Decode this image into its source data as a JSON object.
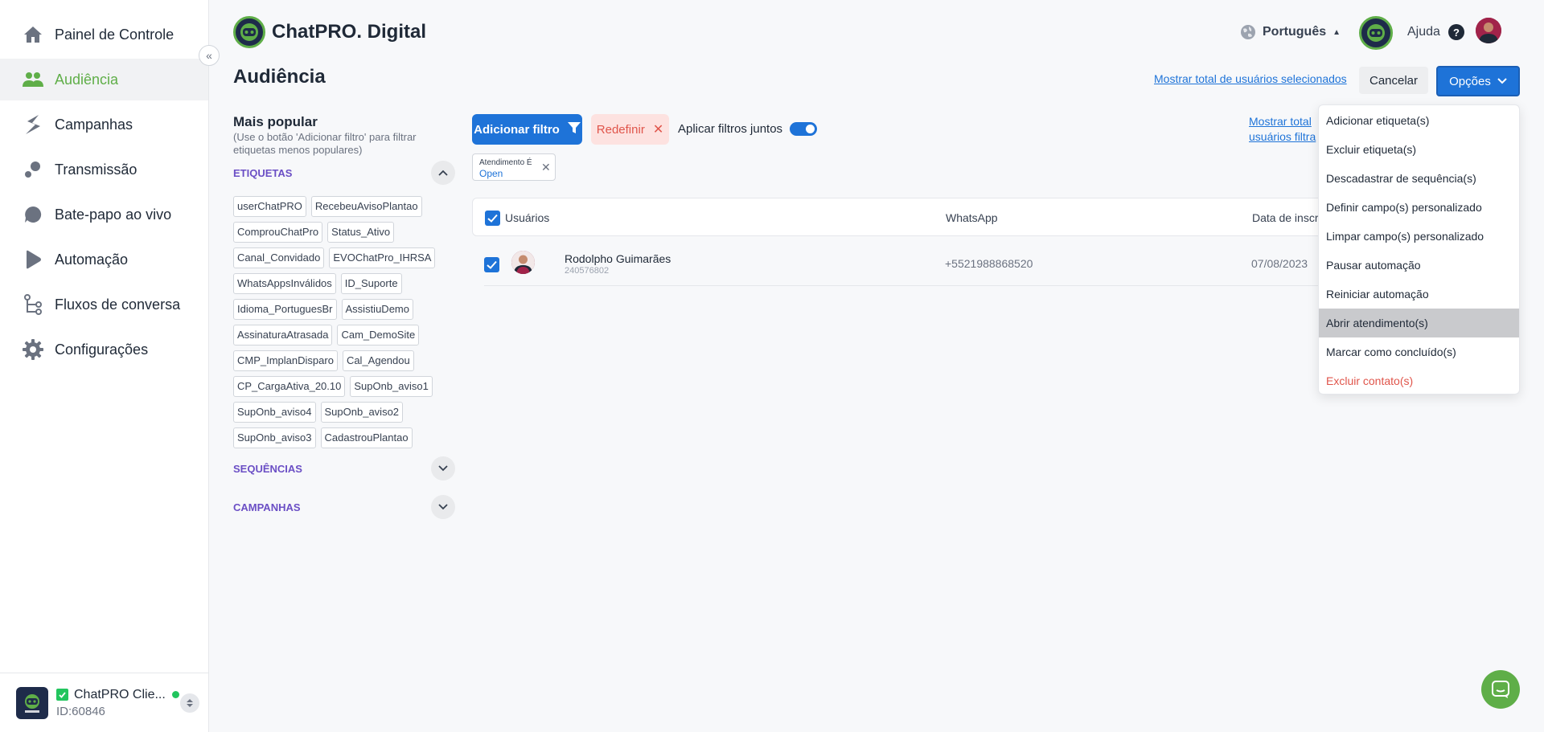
{
  "sidebar": {
    "items": [
      {
        "label": "Painel de Controle",
        "icon": "home-icon",
        "active": false
      },
      {
        "label": "Audiência",
        "icon": "users-icon",
        "active": true
      },
      {
        "label": "Campanhas",
        "icon": "campaigns-icon",
        "active": false
      },
      {
        "label": "Transmissão",
        "icon": "broadcast-icon",
        "active": false
      },
      {
        "label": "Bate-papo ao vivo",
        "icon": "chat-bubble-icon",
        "active": false
      },
      {
        "label": "Automação",
        "icon": "play-icon",
        "active": false
      },
      {
        "label": "Fluxos de conversa",
        "icon": "flow-icon",
        "active": false
      },
      {
        "label": "Configurações",
        "icon": "gear-icon",
        "active": false
      }
    ],
    "collapse_glyph": "«",
    "footer": {
      "name": "ChatPRO Clie...",
      "id": "ID:60846",
      "logo_text": "ChatPRO"
    }
  },
  "header": {
    "brand": "ChatPRO. Digital",
    "language": "Português",
    "help": "Ajuda"
  },
  "page": {
    "title": "Audiência",
    "show_total_link": "Mostrar total de usuários selecionados",
    "cancel": "Cancelar",
    "options": "Opções"
  },
  "filters_panel": {
    "title": "Mais popular",
    "hint": "(Use o botão 'Adicionar filtro' para filtrar etiquetas menos populares)",
    "sections": {
      "tags": "ETIQUETAS",
      "sequences": "SEQUÊNCIAS",
      "campaigns": "CAMPANHAS"
    },
    "tags": [
      "userChatPRO",
      "RecebeuAvisoPlantao",
      "ComprouChatPro",
      "Status_Ativo",
      "Canal_Convidado",
      "EVOChatPro_IHRSA",
      "WhatsAppsInválidos",
      "ID_Suporte",
      "Idioma_PortuguesBr",
      "AssistiuDemo",
      "AssinaturaAtrasada",
      "Cam_DemoSite",
      "CMP_ImplanDisparo",
      "Cal_Agendou",
      "CP_CargaAtiva_20.10",
      "SupOnb_aviso1",
      "SupOnb_aviso4",
      "SupOnb_aviso2",
      "SupOnb_aviso3",
      "CadastrouPlantao"
    ]
  },
  "filter_bar": {
    "add_filter": "Adicionar filtro",
    "reset": "Redefinir",
    "apply_together": "Aplicar filtros juntos",
    "apply_together_on": true,
    "show_total_line1": "Mostrar total",
    "show_total_line2": "usuários filtra",
    "active_filter": {
      "label": "Atendimento É",
      "value": "Open"
    }
  },
  "table": {
    "headers": {
      "users": "Usuários",
      "whatsapp": "WhatsApp",
      "date": "Data de inscri"
    },
    "rows": [
      {
        "name": "Rodolpho Guimarães",
        "id": "240576802",
        "phone": "+5521988868520",
        "date": "07/08/2023",
        "checked": true
      }
    ]
  },
  "options_menu": {
    "items": [
      {
        "label": "Adicionar etiqueta(s)"
      },
      {
        "label": "Excluir etiqueta(s)"
      },
      {
        "label": "Descadastrar de sequência(s)"
      },
      {
        "label": "Definir campo(s) personalizado"
      },
      {
        "label": "Limpar campo(s) personalizado"
      },
      {
        "label": "Pausar automação"
      },
      {
        "label": "Reiniciar automação"
      },
      {
        "label": "Abrir atendimento(s)",
        "highlighted": true
      },
      {
        "label": "Marcar como concluído(s)"
      },
      {
        "label": "Excluir contato(s)",
        "danger": true
      }
    ]
  },
  "colors": {
    "accent": "#1e73d8",
    "active_nav": "#5fae48",
    "danger": "#e0554b",
    "section": "#6b4fc5"
  }
}
